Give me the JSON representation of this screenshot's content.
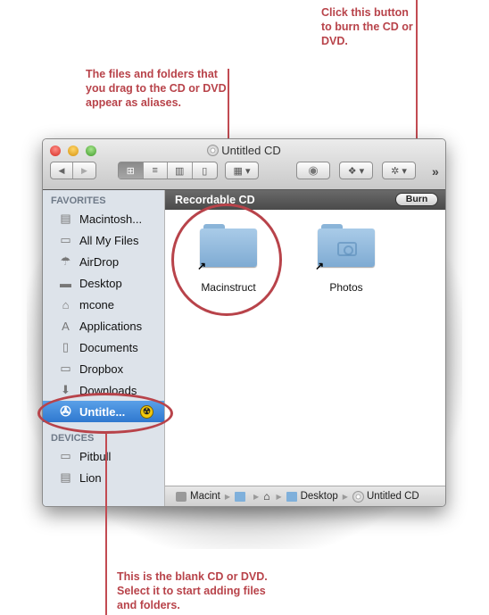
{
  "annotations": {
    "burn": "Click this button to burn the CD or DVD.",
    "aliases": "The files and folders that you drag to the CD or DVD appear as aliases.",
    "blank_cd": "This is the blank CD or DVD. Select it to start adding files and folders."
  },
  "window": {
    "title": "Untitled CD",
    "title_icon": "cd-icon",
    "traffic_lights": [
      "close",
      "minimize",
      "zoom"
    ],
    "toolbar": {
      "back_icon": "◀",
      "forward_icon": "▶",
      "view_modes": [
        {
          "name": "icon-view",
          "glyph": "⊞",
          "selected": true
        },
        {
          "name": "list-view",
          "glyph": "≡",
          "selected": false
        },
        {
          "name": "column-view",
          "glyph": "▥",
          "selected": false
        },
        {
          "name": "coverflow-view",
          "glyph": "▯",
          "selected": false
        }
      ],
      "arrange_glyph": "▦ ▾",
      "quicklook_glyph": "◉",
      "dropbox_glyph": "❖ ▾",
      "action_glyph": "✲ ▾",
      "overflow_glyph": "»"
    }
  },
  "sidebar": {
    "favorites_header": "FAVORITES",
    "favorites": [
      {
        "label": "Macintosh...",
        "icon": "hard-drive-icon",
        "glyph": "▤"
      },
      {
        "label": "All My Files",
        "icon": "all-files-icon",
        "glyph": "▭"
      },
      {
        "label": "AirDrop",
        "icon": "airdrop-icon",
        "glyph": "☂"
      },
      {
        "label": "Desktop",
        "icon": "desktop-icon",
        "glyph": "▬"
      },
      {
        "label": "mcone",
        "icon": "home-icon",
        "glyph": "⌂"
      },
      {
        "label": "Applications",
        "icon": "applications-icon",
        "glyph": "A"
      },
      {
        "label": "Documents",
        "icon": "documents-icon",
        "glyph": "▯"
      },
      {
        "label": "Dropbox",
        "icon": "folder-icon",
        "glyph": "▭"
      },
      {
        "label": "Downloads",
        "icon": "downloads-icon",
        "glyph": "⬇"
      },
      {
        "label": "Untitle...",
        "icon": "cd-icon",
        "glyph": "✇",
        "selected": true,
        "badge": "burn-icon"
      }
    ],
    "devices_header": "DEVICES",
    "devices": [
      {
        "label": "Pitbull",
        "icon": "laptop-icon",
        "glyph": "▭"
      },
      {
        "label": "Lion",
        "icon": "hard-drive-icon",
        "glyph": "▤"
      }
    ]
  },
  "content": {
    "header_label": "Recordable CD",
    "burn_button": "Burn",
    "items": [
      {
        "name": "Macinstruct",
        "type": "folder-alias"
      },
      {
        "name": "Photos",
        "type": "pictures-folder-alias"
      }
    ]
  },
  "pathbar": {
    "items": [
      {
        "label": "Macint",
        "icon": "hard-drive-icon"
      },
      {
        "label": "",
        "icon": "users-folder-icon"
      },
      {
        "label": "",
        "icon": "home-icon"
      },
      {
        "label": "Desktop",
        "icon": "desktop-folder-icon"
      },
      {
        "label": "Untitled CD",
        "icon": "cd-icon"
      }
    ],
    "separator": "▶"
  }
}
